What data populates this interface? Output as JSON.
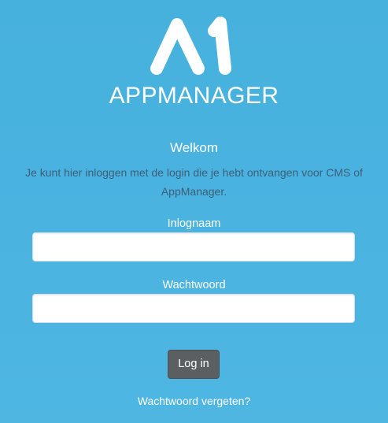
{
  "branding": {
    "logo_icon": "appmanager-a1-logo-icon",
    "brand_name": "APPMANAGER"
  },
  "welcome": {
    "title": "Welkom",
    "message": "Je kunt hier inloggen met de login die je hebt ontvangen voor CMS of AppManager."
  },
  "form": {
    "username_label": "Inlognaam",
    "username_value": "",
    "password_label": "Wachtwoord",
    "password_value": "",
    "submit_label": "Log in",
    "forgot_password_label": "Wachtwoord vergeten?"
  },
  "colors": {
    "background": "#4ab3e0",
    "text_light": "#ffffff",
    "text_muted": "#3d5f79",
    "button": "#5b5f61"
  }
}
